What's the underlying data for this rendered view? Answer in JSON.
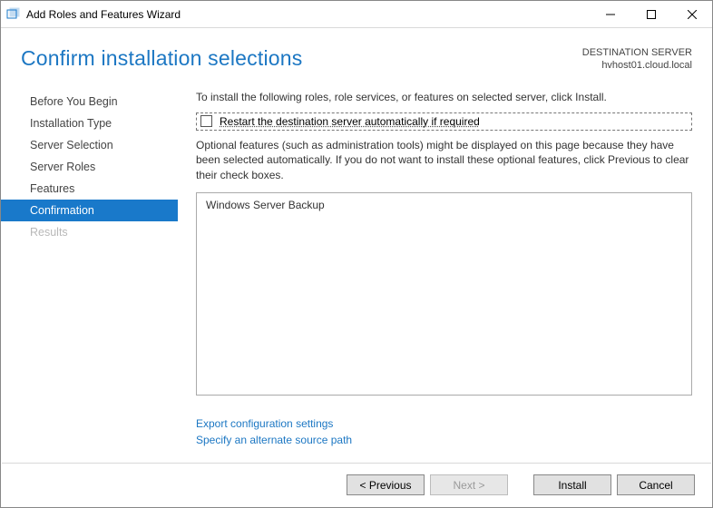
{
  "window": {
    "title": "Add Roles and Features Wizard"
  },
  "header": {
    "heading": "Confirm installation selections",
    "destination_label": "DESTINATION SERVER",
    "destination_value": "hvhost01.cloud.local"
  },
  "sidebar": {
    "steps": [
      {
        "label": "Before You Begin",
        "selected": false,
        "disabled": false
      },
      {
        "label": "Installation Type",
        "selected": false,
        "disabled": false
      },
      {
        "label": "Server Selection",
        "selected": false,
        "disabled": false
      },
      {
        "label": "Server Roles",
        "selected": false,
        "disabled": false
      },
      {
        "label": "Features",
        "selected": false,
        "disabled": false
      },
      {
        "label": "Confirmation",
        "selected": true,
        "disabled": false
      },
      {
        "label": "Results",
        "selected": false,
        "disabled": true
      }
    ]
  },
  "content": {
    "instruction": "To install the following roles, role services, or features on selected server, click Install.",
    "restart_checkbox_label": "Restart the destination server automatically if required",
    "restart_checked": false,
    "optional_text": "Optional features (such as administration tools) might be displayed on this page because they have been selected automatically. If you do not want to install these optional features, click Previous to clear their check boxes.",
    "selected_features": [
      "Windows Server Backup"
    ],
    "links": {
      "export": "Export configuration settings",
      "alt_source": "Specify an alternate source path"
    }
  },
  "footer": {
    "previous": "< Previous",
    "next": "Next >",
    "install": "Install",
    "cancel": "Cancel",
    "next_enabled": false
  }
}
